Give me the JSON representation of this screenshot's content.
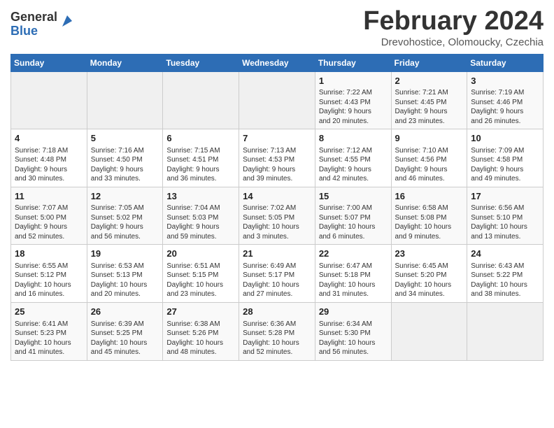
{
  "header": {
    "logo_general": "General",
    "logo_blue": "Blue",
    "title": "February 2024",
    "location": "Drevohostice, Olomoucky, Czechia"
  },
  "days_of_week": [
    "Sunday",
    "Monday",
    "Tuesday",
    "Wednesday",
    "Thursday",
    "Friday",
    "Saturday"
  ],
  "weeks": [
    [
      {
        "day": "",
        "content": ""
      },
      {
        "day": "",
        "content": ""
      },
      {
        "day": "",
        "content": ""
      },
      {
        "day": "",
        "content": ""
      },
      {
        "day": "1",
        "content": "Sunrise: 7:22 AM\nSunset: 4:43 PM\nDaylight: 9 hours\nand 20 minutes."
      },
      {
        "day": "2",
        "content": "Sunrise: 7:21 AM\nSunset: 4:45 PM\nDaylight: 9 hours\nand 23 minutes."
      },
      {
        "day": "3",
        "content": "Sunrise: 7:19 AM\nSunset: 4:46 PM\nDaylight: 9 hours\nand 26 minutes."
      }
    ],
    [
      {
        "day": "4",
        "content": "Sunrise: 7:18 AM\nSunset: 4:48 PM\nDaylight: 9 hours\nand 30 minutes."
      },
      {
        "day": "5",
        "content": "Sunrise: 7:16 AM\nSunset: 4:50 PM\nDaylight: 9 hours\nand 33 minutes."
      },
      {
        "day": "6",
        "content": "Sunrise: 7:15 AM\nSunset: 4:51 PM\nDaylight: 9 hours\nand 36 minutes."
      },
      {
        "day": "7",
        "content": "Sunrise: 7:13 AM\nSunset: 4:53 PM\nDaylight: 9 hours\nand 39 minutes."
      },
      {
        "day": "8",
        "content": "Sunrise: 7:12 AM\nSunset: 4:55 PM\nDaylight: 9 hours\nand 42 minutes."
      },
      {
        "day": "9",
        "content": "Sunrise: 7:10 AM\nSunset: 4:56 PM\nDaylight: 9 hours\nand 46 minutes."
      },
      {
        "day": "10",
        "content": "Sunrise: 7:09 AM\nSunset: 4:58 PM\nDaylight: 9 hours\nand 49 minutes."
      }
    ],
    [
      {
        "day": "11",
        "content": "Sunrise: 7:07 AM\nSunset: 5:00 PM\nDaylight: 9 hours\nand 52 minutes."
      },
      {
        "day": "12",
        "content": "Sunrise: 7:05 AM\nSunset: 5:02 PM\nDaylight: 9 hours\nand 56 minutes."
      },
      {
        "day": "13",
        "content": "Sunrise: 7:04 AM\nSunset: 5:03 PM\nDaylight: 9 hours\nand 59 minutes."
      },
      {
        "day": "14",
        "content": "Sunrise: 7:02 AM\nSunset: 5:05 PM\nDaylight: 10 hours\nand 3 minutes."
      },
      {
        "day": "15",
        "content": "Sunrise: 7:00 AM\nSunset: 5:07 PM\nDaylight: 10 hours\nand 6 minutes."
      },
      {
        "day": "16",
        "content": "Sunrise: 6:58 AM\nSunset: 5:08 PM\nDaylight: 10 hours\nand 9 minutes."
      },
      {
        "day": "17",
        "content": "Sunrise: 6:56 AM\nSunset: 5:10 PM\nDaylight: 10 hours\nand 13 minutes."
      }
    ],
    [
      {
        "day": "18",
        "content": "Sunrise: 6:55 AM\nSunset: 5:12 PM\nDaylight: 10 hours\nand 16 minutes."
      },
      {
        "day": "19",
        "content": "Sunrise: 6:53 AM\nSunset: 5:13 PM\nDaylight: 10 hours\nand 20 minutes."
      },
      {
        "day": "20",
        "content": "Sunrise: 6:51 AM\nSunset: 5:15 PM\nDaylight: 10 hours\nand 23 minutes."
      },
      {
        "day": "21",
        "content": "Sunrise: 6:49 AM\nSunset: 5:17 PM\nDaylight: 10 hours\nand 27 minutes."
      },
      {
        "day": "22",
        "content": "Sunrise: 6:47 AM\nSunset: 5:18 PM\nDaylight: 10 hours\nand 31 minutes."
      },
      {
        "day": "23",
        "content": "Sunrise: 6:45 AM\nSunset: 5:20 PM\nDaylight: 10 hours\nand 34 minutes."
      },
      {
        "day": "24",
        "content": "Sunrise: 6:43 AM\nSunset: 5:22 PM\nDaylight: 10 hours\nand 38 minutes."
      }
    ],
    [
      {
        "day": "25",
        "content": "Sunrise: 6:41 AM\nSunset: 5:23 PM\nDaylight: 10 hours\nand 41 minutes."
      },
      {
        "day": "26",
        "content": "Sunrise: 6:39 AM\nSunset: 5:25 PM\nDaylight: 10 hours\nand 45 minutes."
      },
      {
        "day": "27",
        "content": "Sunrise: 6:38 AM\nSunset: 5:26 PM\nDaylight: 10 hours\nand 48 minutes."
      },
      {
        "day": "28",
        "content": "Sunrise: 6:36 AM\nSunset: 5:28 PM\nDaylight: 10 hours\nand 52 minutes."
      },
      {
        "day": "29",
        "content": "Sunrise: 6:34 AM\nSunset: 5:30 PM\nDaylight: 10 hours\nand 56 minutes."
      },
      {
        "day": "",
        "content": ""
      },
      {
        "day": "",
        "content": ""
      }
    ]
  ]
}
